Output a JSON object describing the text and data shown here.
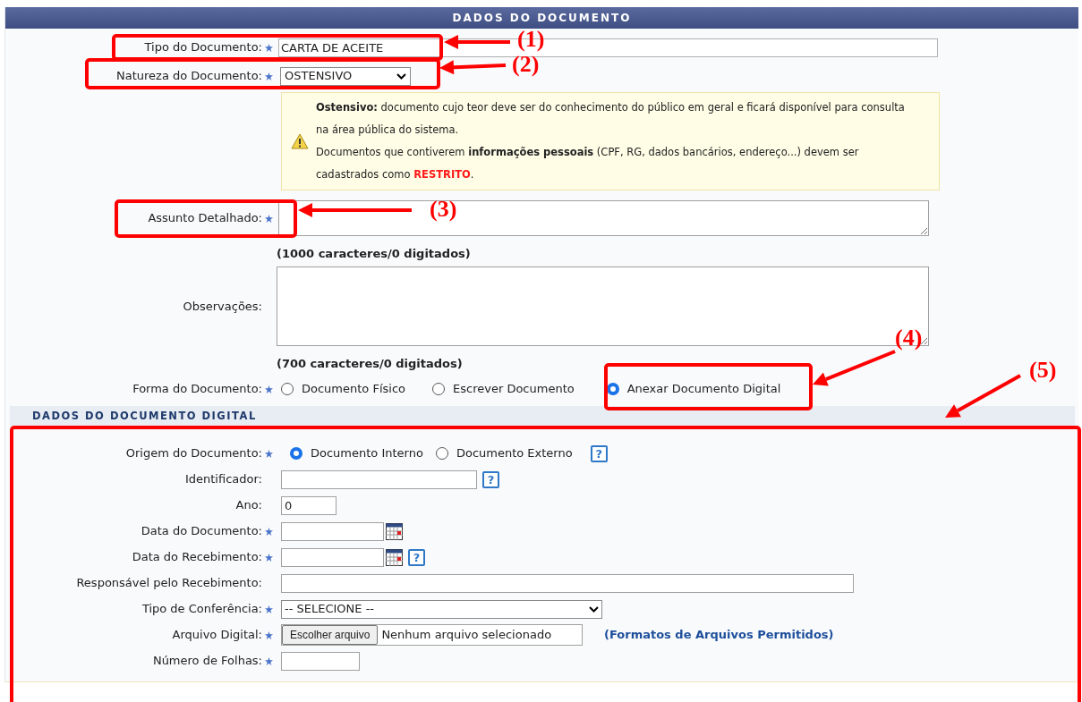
{
  "header": {
    "title": "DADOS DO DOCUMENTO"
  },
  "tipo_documento": {
    "label": "Tipo do Documento:",
    "required": true,
    "value": "CARTA DE ACEITE"
  },
  "natureza_documento": {
    "label": "Natureza do Documento:",
    "required": true,
    "value": "OSTENSIVO"
  },
  "note": {
    "paragraphs": [
      {
        "text": "**Ostensivo:** documento cujo teor deve ser do conhecimento do público em geral e ficará disponível para consulta na área pública do sistema."
      },
      {
        "text": "Documentos que contiverem **informações pessoais** (CPF, RG, dados bancários, endereço...) devem ser cadastrados como ",
        "highlight": "RESTRITO",
        "tail": "."
      }
    ]
  },
  "assunto": {
    "label": "Assunto Detalhado:",
    "required": true,
    "counter": "(1000 caracteres/0 digitados)"
  },
  "observacoes": {
    "label": "Observações:",
    "required": false,
    "counter": "(700 caracteres/0 digitados)"
  },
  "forma": {
    "label": "Forma do Documento:",
    "required": true,
    "options": [
      {
        "label": "Documento Físico",
        "selected": false
      },
      {
        "label": "Escrever Documento",
        "selected": false
      },
      {
        "label": "Anexar Documento Digital",
        "selected": true
      }
    ]
  },
  "digital_section": {
    "title": "DADOS DO DOCUMENTO DIGITAL",
    "fields": [
      {
        "kind": "radio",
        "label": "Origem do Documento:",
        "required": true,
        "options": [
          {
            "label": "Documento Interno",
            "selected": true
          },
          {
            "label": "Documento Externo",
            "selected": false
          }
        ],
        "help": "?"
      },
      {
        "kind": "text",
        "label": "Identificador:",
        "required": false,
        "help": "?"
      },
      {
        "kind": "text",
        "label": "Ano:",
        "required": false,
        "value": "0"
      },
      {
        "kind": "date",
        "label": "Data do Documento:",
        "required": true
      },
      {
        "kind": "date",
        "label": "Data do Recebimento:",
        "required": true,
        "help": "?"
      },
      {
        "kind": "text",
        "label": "Responsável pelo Recebimento:",
        "required": false
      },
      {
        "kind": "select",
        "label": "Tipo de Conferência:",
        "required": true,
        "value": "-- SELECIONE --"
      },
      {
        "kind": "file",
        "label": "Arquivo Digital:",
        "required": true,
        "button": "Escolher arquivo",
        "status": "Nenhum arquivo selecionado",
        "link": "(Formatos de Arquivos Permitidos)"
      },
      {
        "kind": "text",
        "label": "Número de Folhas:",
        "required": true
      }
    ]
  },
  "annotations": [
    {
      "label": "(1)"
    },
    {
      "label": "(2)"
    },
    {
      "label": "(3)"
    },
    {
      "label": "(4)"
    },
    {
      "label": "(5)"
    }
  ]
}
